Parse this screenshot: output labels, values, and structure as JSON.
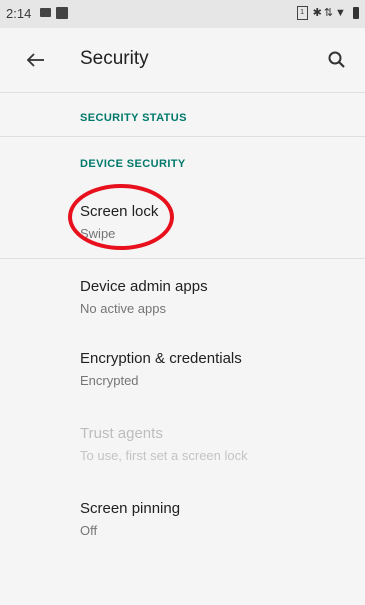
{
  "status_bar": {
    "time": "2:14",
    "sim_label": "1"
  },
  "header": {
    "title": "Security"
  },
  "sections": {
    "security_status": "SECURITY STATUS",
    "device_security": "DEVICE SECURITY"
  },
  "items": [
    {
      "title": "Screen lock",
      "summary": "Swipe",
      "enabled": true
    },
    {
      "title": "Device admin apps",
      "summary": "No active apps",
      "enabled": true
    },
    {
      "title": "Encryption & credentials",
      "summary": "Encrypted",
      "enabled": true
    },
    {
      "title": "Trust agents",
      "summary": "To use, first set a screen lock",
      "enabled": false
    },
    {
      "title": "Screen pinning",
      "summary": "Off",
      "enabled": true
    }
  ],
  "colors": {
    "accent": "#00796b",
    "highlight": "#e8101d",
    "background": "#f5f5f5"
  },
  "icons": {
    "back": "arrow-back-icon",
    "search": "search-icon"
  }
}
